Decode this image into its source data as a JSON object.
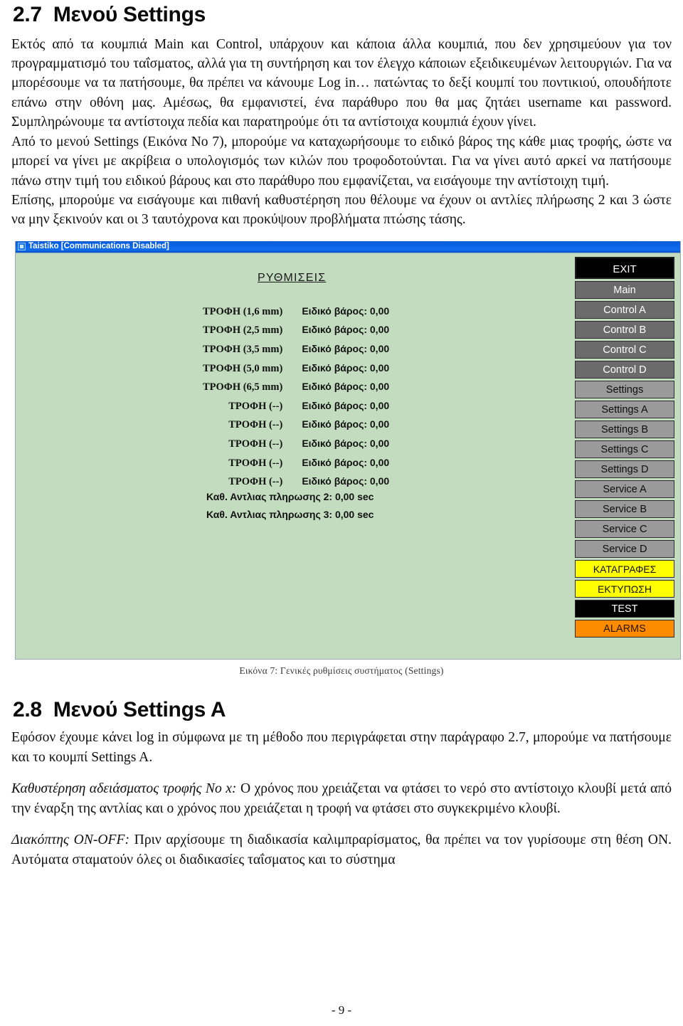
{
  "document": {
    "section_27": {
      "number": "2.7",
      "title": "Μενού Settings",
      "paragraphs": [
        "Εκτός από τα κουμπιά Main και Control, υπάρχουν και κάποια άλλα κουμπιά, που δεν χρησιμεύουν για τον προγραμματισμό του ταΐσματος, αλλά για τη συντήρηση και τον έλεγχο κάποιων εξειδικευμένων λειτουργιών. Για να μπορέσουμε να τα πατήσουμε, θα πρέπει να κάνουμε Log in… πατώντας το δεξί κουμπί του ποντικιού, οπουδήποτε επάνω στην οθόνη μας. Αμέσως, θα εμφανιστεί, ένα παράθυρο που θα μας ζητάει username και password. Συμπληρώνουμε τα αντίστοιχα πεδία και παρατηρούμε ότι τα αντίστοιχα κουμπιά έχουν γίνει.",
        "Από το μενού Settings (Εικόνα No 7), μπορούμε να καταχωρήσουμε το ειδικό βάρος της κάθε μιας τροφής, ώστε να μπορεί να γίνει με ακρίβεια ο υπολογισμός των κιλών που τροφοδοτούνται. Για να γίνει αυτό αρκεί να πατήσουμε πάνω στην τιμή του ειδικού βάρους και στο παράθυρο που εμφανίζεται, να εισάγουμε την αντίστοιχη τιμή.",
        "Επίσης, μπορούμε να εισάγουμε και πιθανή καθυστέρηση που θέλουμε να έχουν οι αντλίες πλήρωσης 2 και 3 ώστε να μην ξεκινούν και οι 3 ταυτόχρονα και προκύψουν προβλήματα πτώσης τάσης."
      ]
    },
    "figure": {
      "caption": "Εικόνα 7: Γενικές ρυθμίσεις συστήματος (Settings)"
    },
    "section_28": {
      "number": "2.8",
      "title": "Μενού Settings A",
      "paragraph_1": "Εφόσον έχουμε κάνει log in σύμφωνα με τη μέθοδο που περιγράφεται στην παράγραφο 2.7, μπορούμε να πατήσουμε και το κουμπί Settings A.",
      "term_1_label": "Καθυστέρηση αδειάσματος τροφής Νο x:",
      "term_1_text": " Ο χρόνος που χρειάζεται να φτάσει το νερό στο αντίστοιχο κλουβί μετά από την έναρξη της αντλίας και ο χρόνος που χρειάζεται η τροφή να φτάσει στο συγκεκριμένο κλουβί.",
      "term_2_label": "Διακόπτης ΟΝ-OFF:",
      "term_2_text": " Πριν αρχίσουμε τη διαδικασία καλιμπραρίσματος, θα πρέπει να τον γυρίσουμε στη θέση ΟΝ. Αυτόματα σταματούν όλες οι διαδικασίες ταΐσματος και το σύστημα"
    },
    "page_number": "- 9 -"
  },
  "app": {
    "titlebar": {
      "title": "Taistiko [Communications Disabled]"
    },
    "panel": {
      "heading": "ΡΥΘΜΙΣΕΙΣ",
      "food_rows": [
        {
          "name": "ΤΡΟΦΗ (1,6 mm)",
          "value": "Ειδικό βάρος: 0,00"
        },
        {
          "name": "ΤΡΟΦΗ (2,5 mm)",
          "value": "Ειδικό βάρος: 0,00"
        },
        {
          "name": "ΤΡΟΦΗ (3,5 mm)",
          "value": "Ειδικό βάρος: 0,00"
        },
        {
          "name": "ΤΡΟΦΗ (5,0 mm)",
          "value": "Ειδικό βάρος: 0,00"
        },
        {
          "name": "ΤΡΟΦΗ (6,5 mm)",
          "value": "Ειδικό βάρος: 0,00"
        },
        {
          "name": "ΤΡΟΦΗ (--)",
          "value": "Ειδικό βάρος: 0,00"
        },
        {
          "name": "ΤΡΟΦΗ (--)",
          "value": "Ειδικό βάρος: 0,00"
        },
        {
          "name": "ΤΡΟΦΗ (--)",
          "value": "Ειδικό βάρος: 0,00"
        },
        {
          "name": "ΤΡΟΦΗ (--)",
          "value": "Ειδικό βάρος: 0,00"
        },
        {
          "name": "ΤΡΟΦΗ (--)",
          "value": "Ειδικό βάρος: 0,00"
        }
      ],
      "pump_rows": [
        "Καθ. Αντλιας πληρωσης 2: 0,00 sec",
        "Καθ. Αντλιας πληρωσης 3: 0,00 sec"
      ]
    },
    "buttons": [
      {
        "label": "EXIT",
        "style": "exit"
      },
      {
        "label": "Main",
        "style": "dark"
      },
      {
        "label": "Control A",
        "style": "dark"
      },
      {
        "label": "Control B",
        "style": "dark"
      },
      {
        "label": "Control C",
        "style": "dark"
      },
      {
        "label": "Control D",
        "style": "dark"
      },
      {
        "label": "Settings",
        "style": "light"
      },
      {
        "label": "Settings A",
        "style": "light"
      },
      {
        "label": "Settings B",
        "style": "light"
      },
      {
        "label": "Settings C",
        "style": "light"
      },
      {
        "label": "Settings D",
        "style": "light"
      },
      {
        "label": "Service A",
        "style": "light"
      },
      {
        "label": "Service B",
        "style": "light"
      },
      {
        "label": "Service C",
        "style": "light"
      },
      {
        "label": "Service D",
        "style": "light"
      },
      {
        "label": "ΚΑΤΑΓΡΑΦΕΣ",
        "style": "yellow"
      },
      {
        "label": "ΕΚΤΥΠΩΣΗ",
        "style": "yellow"
      },
      {
        "label": "TEST",
        "style": "black"
      },
      {
        "label": "ALARMS",
        "style": "orange"
      }
    ],
    "colors": {
      "background": "#c3dcc0",
      "titlebar": "#0b62e4",
      "button_dark": "#6b6b6b",
      "button_light": "#9a9a9a",
      "button_yellow": "#ffff00",
      "button_orange": "#ff8c00",
      "button_black": "#000000"
    }
  }
}
